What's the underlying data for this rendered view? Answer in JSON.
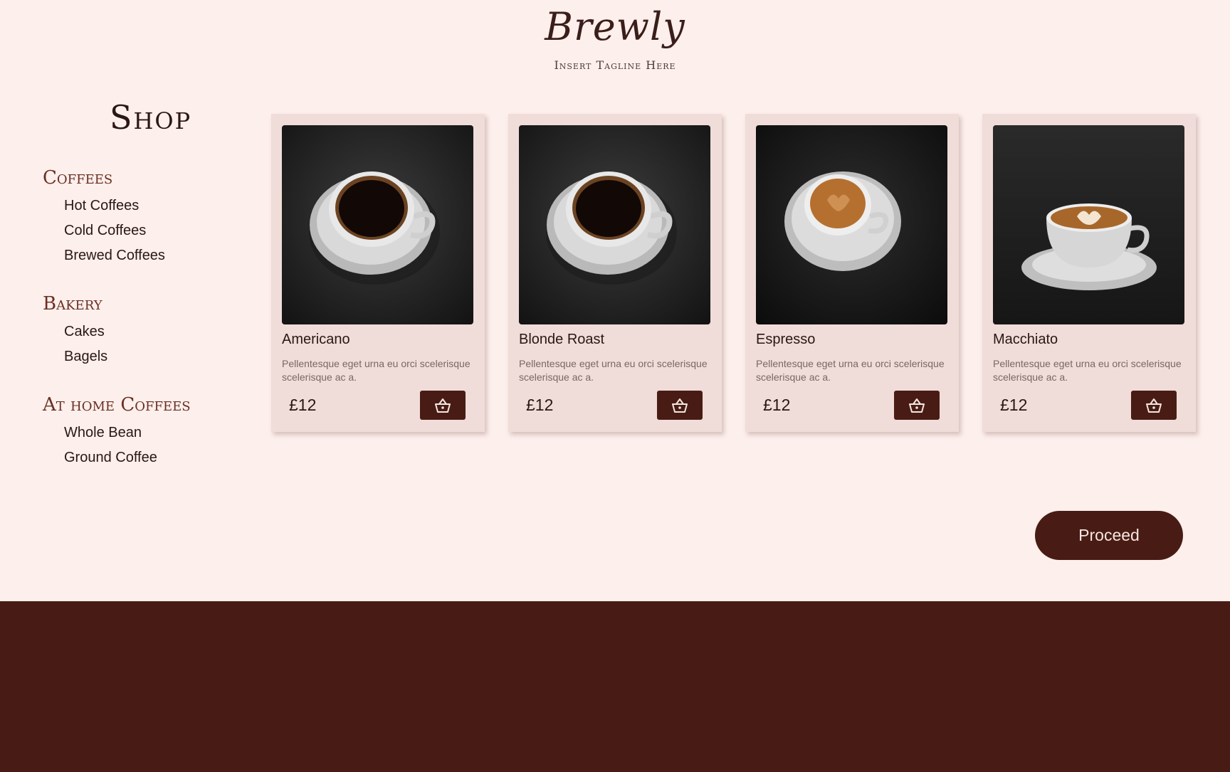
{
  "header": {
    "brand": "Brewly",
    "tagline": "Insert Tagline Here"
  },
  "sidebar": {
    "title": "Shop",
    "categories": [
      {
        "label": "Coffees",
        "items": [
          "Hot Coffees",
          "Cold Coffees",
          "Brewed Coffees"
        ]
      },
      {
        "label": "Bakery",
        "items": [
          "Cakes",
          "Bagels"
        ]
      },
      {
        "label": "At home Coffees",
        "items": [
          "Whole Bean",
          "Ground Coffee"
        ]
      }
    ]
  },
  "products": [
    {
      "name": "Americano",
      "description": "Pellentesque eget urna eu orci scelerisque scelerisque ac a.",
      "price": "£12",
      "image": "black-coffee-cup-photo",
      "cart_icon": "basket-icon"
    },
    {
      "name": "Blonde Roast",
      "description": "Pellentesque eget urna eu orci scelerisque scelerisque ac a.",
      "price": "£12",
      "image": "black-coffee-cup-photo",
      "cart_icon": "basket-icon"
    },
    {
      "name": "Espresso",
      "description": "Pellentesque eget urna eu orci scelerisque scelerisque ac a.",
      "price": "£12",
      "image": "espresso-cup-photo",
      "cart_icon": "basket-icon"
    },
    {
      "name": "Macchiato",
      "description": "Pellentesque eget urna eu orci scelerisque scelerisque ac a.",
      "price": "£12",
      "image": "latte-art-cup-photo",
      "cart_icon": "basket-icon"
    }
  ],
  "actions": {
    "proceed_label": "Proceed"
  },
  "colors": {
    "page_background": "#fcefec",
    "card_background": "#f0dcd8",
    "accent_dark": "#481c15",
    "category_text": "#6b2f22",
    "body_text": "#2a1714",
    "muted_text": "#7a6663"
  }
}
